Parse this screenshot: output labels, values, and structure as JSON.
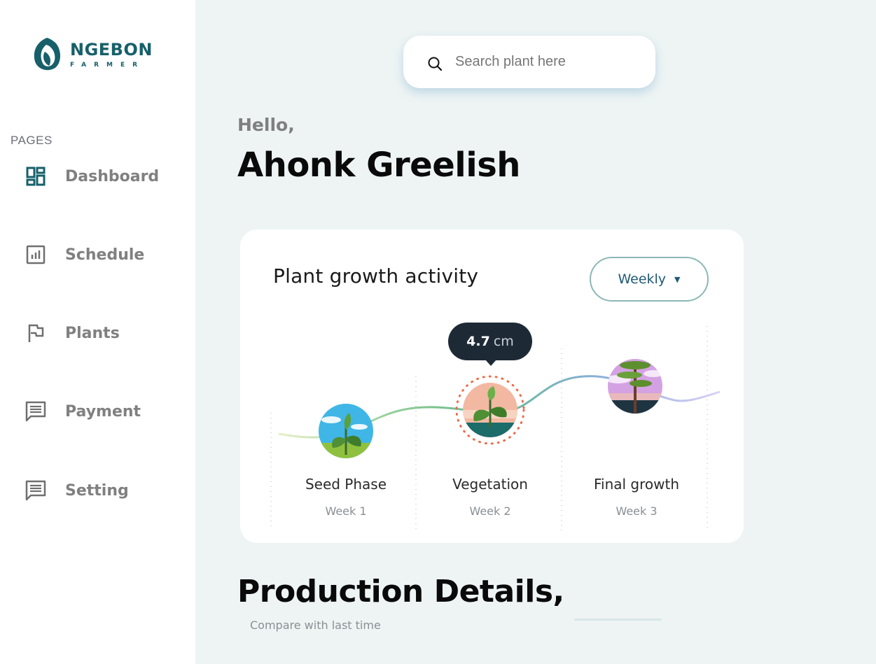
{
  "brand": {
    "name": "NGEBON",
    "sub": "FARMER",
    "color": "#17606a"
  },
  "sidebar": {
    "section_label": "PAGES",
    "items": [
      {
        "label": "Dashboard",
        "icon": "dashboard-icon",
        "active": true
      },
      {
        "label": "Schedule",
        "icon": "chart-icon"
      },
      {
        "label": "Plants",
        "icon": "flag-icon"
      },
      {
        "label": "Payment",
        "icon": "message-icon"
      },
      {
        "label": "Setting",
        "icon": "message-icon"
      }
    ]
  },
  "search": {
    "placeholder": "Search plant here",
    "icon": "search-icon"
  },
  "greeting": {
    "hello": "Hello,",
    "name": "Ahonk Greelish"
  },
  "growth_card": {
    "title": "Plant growth activity",
    "period": "Weekly",
    "tooltip": {
      "value": "4.7",
      "unit": "cm"
    },
    "stages": [
      {
        "title": "Seed Phase",
        "week": "Week 1"
      },
      {
        "title": "Vegetation",
        "week": "Week 2"
      },
      {
        "title": "Final growth",
        "week": "Week 3"
      }
    ]
  },
  "production": {
    "title": "Production Details,",
    "subtitle": "Compare with last time"
  },
  "colors": {
    "background": "#eef4f4",
    "card": "#ffffff",
    "accent": "#17606a",
    "tooltip": "#1d2a36"
  }
}
